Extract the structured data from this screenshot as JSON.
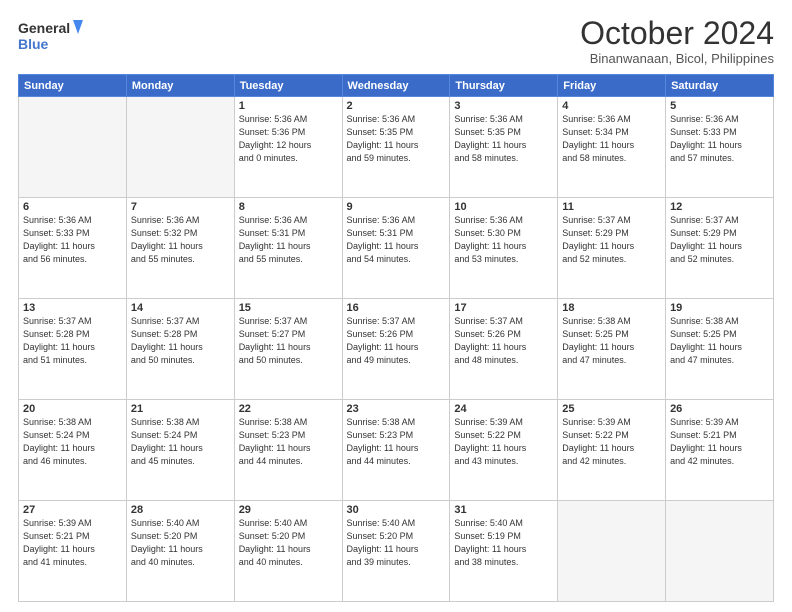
{
  "header": {
    "logo_line1": "General",
    "logo_line2": "Blue",
    "month_title": "October 2024",
    "subtitle": "Binanwanaan, Bicol, Philippines"
  },
  "weekdays": [
    "Sunday",
    "Monday",
    "Tuesday",
    "Wednesday",
    "Thursday",
    "Friday",
    "Saturday"
  ],
  "weeks": [
    [
      {
        "day": "",
        "info": ""
      },
      {
        "day": "",
        "info": ""
      },
      {
        "day": "1",
        "info": "Sunrise: 5:36 AM\nSunset: 5:36 PM\nDaylight: 12 hours\nand 0 minutes."
      },
      {
        "day": "2",
        "info": "Sunrise: 5:36 AM\nSunset: 5:35 PM\nDaylight: 11 hours\nand 59 minutes."
      },
      {
        "day": "3",
        "info": "Sunrise: 5:36 AM\nSunset: 5:35 PM\nDaylight: 11 hours\nand 58 minutes."
      },
      {
        "day": "4",
        "info": "Sunrise: 5:36 AM\nSunset: 5:34 PM\nDaylight: 11 hours\nand 58 minutes."
      },
      {
        "day": "5",
        "info": "Sunrise: 5:36 AM\nSunset: 5:33 PM\nDaylight: 11 hours\nand 57 minutes."
      }
    ],
    [
      {
        "day": "6",
        "info": "Sunrise: 5:36 AM\nSunset: 5:33 PM\nDaylight: 11 hours\nand 56 minutes."
      },
      {
        "day": "7",
        "info": "Sunrise: 5:36 AM\nSunset: 5:32 PM\nDaylight: 11 hours\nand 55 minutes."
      },
      {
        "day": "8",
        "info": "Sunrise: 5:36 AM\nSunset: 5:31 PM\nDaylight: 11 hours\nand 55 minutes."
      },
      {
        "day": "9",
        "info": "Sunrise: 5:36 AM\nSunset: 5:31 PM\nDaylight: 11 hours\nand 54 minutes."
      },
      {
        "day": "10",
        "info": "Sunrise: 5:36 AM\nSunset: 5:30 PM\nDaylight: 11 hours\nand 53 minutes."
      },
      {
        "day": "11",
        "info": "Sunrise: 5:37 AM\nSunset: 5:29 PM\nDaylight: 11 hours\nand 52 minutes."
      },
      {
        "day": "12",
        "info": "Sunrise: 5:37 AM\nSunset: 5:29 PM\nDaylight: 11 hours\nand 52 minutes."
      }
    ],
    [
      {
        "day": "13",
        "info": "Sunrise: 5:37 AM\nSunset: 5:28 PM\nDaylight: 11 hours\nand 51 minutes."
      },
      {
        "day": "14",
        "info": "Sunrise: 5:37 AM\nSunset: 5:28 PM\nDaylight: 11 hours\nand 50 minutes."
      },
      {
        "day": "15",
        "info": "Sunrise: 5:37 AM\nSunset: 5:27 PM\nDaylight: 11 hours\nand 50 minutes."
      },
      {
        "day": "16",
        "info": "Sunrise: 5:37 AM\nSunset: 5:26 PM\nDaylight: 11 hours\nand 49 minutes."
      },
      {
        "day": "17",
        "info": "Sunrise: 5:37 AM\nSunset: 5:26 PM\nDaylight: 11 hours\nand 48 minutes."
      },
      {
        "day": "18",
        "info": "Sunrise: 5:38 AM\nSunset: 5:25 PM\nDaylight: 11 hours\nand 47 minutes."
      },
      {
        "day": "19",
        "info": "Sunrise: 5:38 AM\nSunset: 5:25 PM\nDaylight: 11 hours\nand 47 minutes."
      }
    ],
    [
      {
        "day": "20",
        "info": "Sunrise: 5:38 AM\nSunset: 5:24 PM\nDaylight: 11 hours\nand 46 minutes."
      },
      {
        "day": "21",
        "info": "Sunrise: 5:38 AM\nSunset: 5:24 PM\nDaylight: 11 hours\nand 45 minutes."
      },
      {
        "day": "22",
        "info": "Sunrise: 5:38 AM\nSunset: 5:23 PM\nDaylight: 11 hours\nand 44 minutes."
      },
      {
        "day": "23",
        "info": "Sunrise: 5:38 AM\nSunset: 5:23 PM\nDaylight: 11 hours\nand 44 minutes."
      },
      {
        "day": "24",
        "info": "Sunrise: 5:39 AM\nSunset: 5:22 PM\nDaylight: 11 hours\nand 43 minutes."
      },
      {
        "day": "25",
        "info": "Sunrise: 5:39 AM\nSunset: 5:22 PM\nDaylight: 11 hours\nand 42 minutes."
      },
      {
        "day": "26",
        "info": "Sunrise: 5:39 AM\nSunset: 5:21 PM\nDaylight: 11 hours\nand 42 minutes."
      }
    ],
    [
      {
        "day": "27",
        "info": "Sunrise: 5:39 AM\nSunset: 5:21 PM\nDaylight: 11 hours\nand 41 minutes."
      },
      {
        "day": "28",
        "info": "Sunrise: 5:40 AM\nSunset: 5:20 PM\nDaylight: 11 hours\nand 40 minutes."
      },
      {
        "day": "29",
        "info": "Sunrise: 5:40 AM\nSunset: 5:20 PM\nDaylight: 11 hours\nand 40 minutes."
      },
      {
        "day": "30",
        "info": "Sunrise: 5:40 AM\nSunset: 5:20 PM\nDaylight: 11 hours\nand 39 minutes."
      },
      {
        "day": "31",
        "info": "Sunrise: 5:40 AM\nSunset: 5:19 PM\nDaylight: 11 hours\nand 38 minutes."
      },
      {
        "day": "",
        "info": ""
      },
      {
        "day": "",
        "info": ""
      }
    ]
  ]
}
